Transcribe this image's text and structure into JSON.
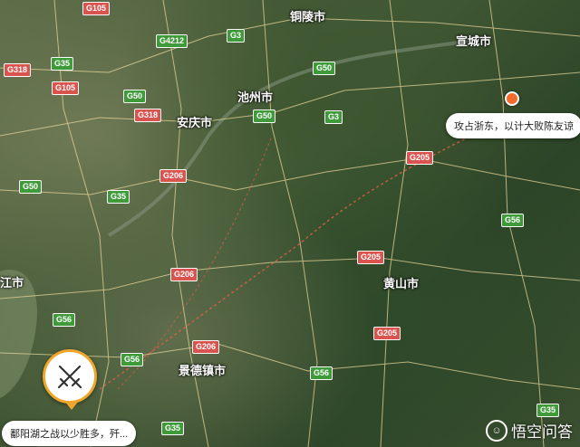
{
  "map": {
    "cities": [
      {
        "id": "tongling",
        "label": "铜陵市"
      },
      {
        "id": "xuancheng",
        "label": "宣城市"
      },
      {
        "id": "chizhou",
        "label": "池州市"
      },
      {
        "id": "anqing",
        "label": "安庆市"
      },
      {
        "id": "huangshan",
        "label": "黄山市"
      },
      {
        "id": "jingdezhen",
        "label": "景德镇市"
      },
      {
        "id": "jiujiang_partial",
        "label": "江市"
      }
    ],
    "highways": [
      "G105",
      "G4212",
      "G3",
      "G35",
      "G318",
      "G105",
      "G50",
      "G318",
      "G50",
      "G3",
      "G50",
      "G206",
      "G50",
      "G35",
      "G205",
      "G56",
      "G206",
      "G205",
      "G205",
      "G206",
      "G56",
      "G56",
      "G56",
      "G35",
      "G35"
    ],
    "callouts": {
      "east": "攻占浙东，以计大败陈友谅",
      "west": "鄱阳湖之战以少胜多，歼..."
    },
    "brand": "悟空问答"
  }
}
